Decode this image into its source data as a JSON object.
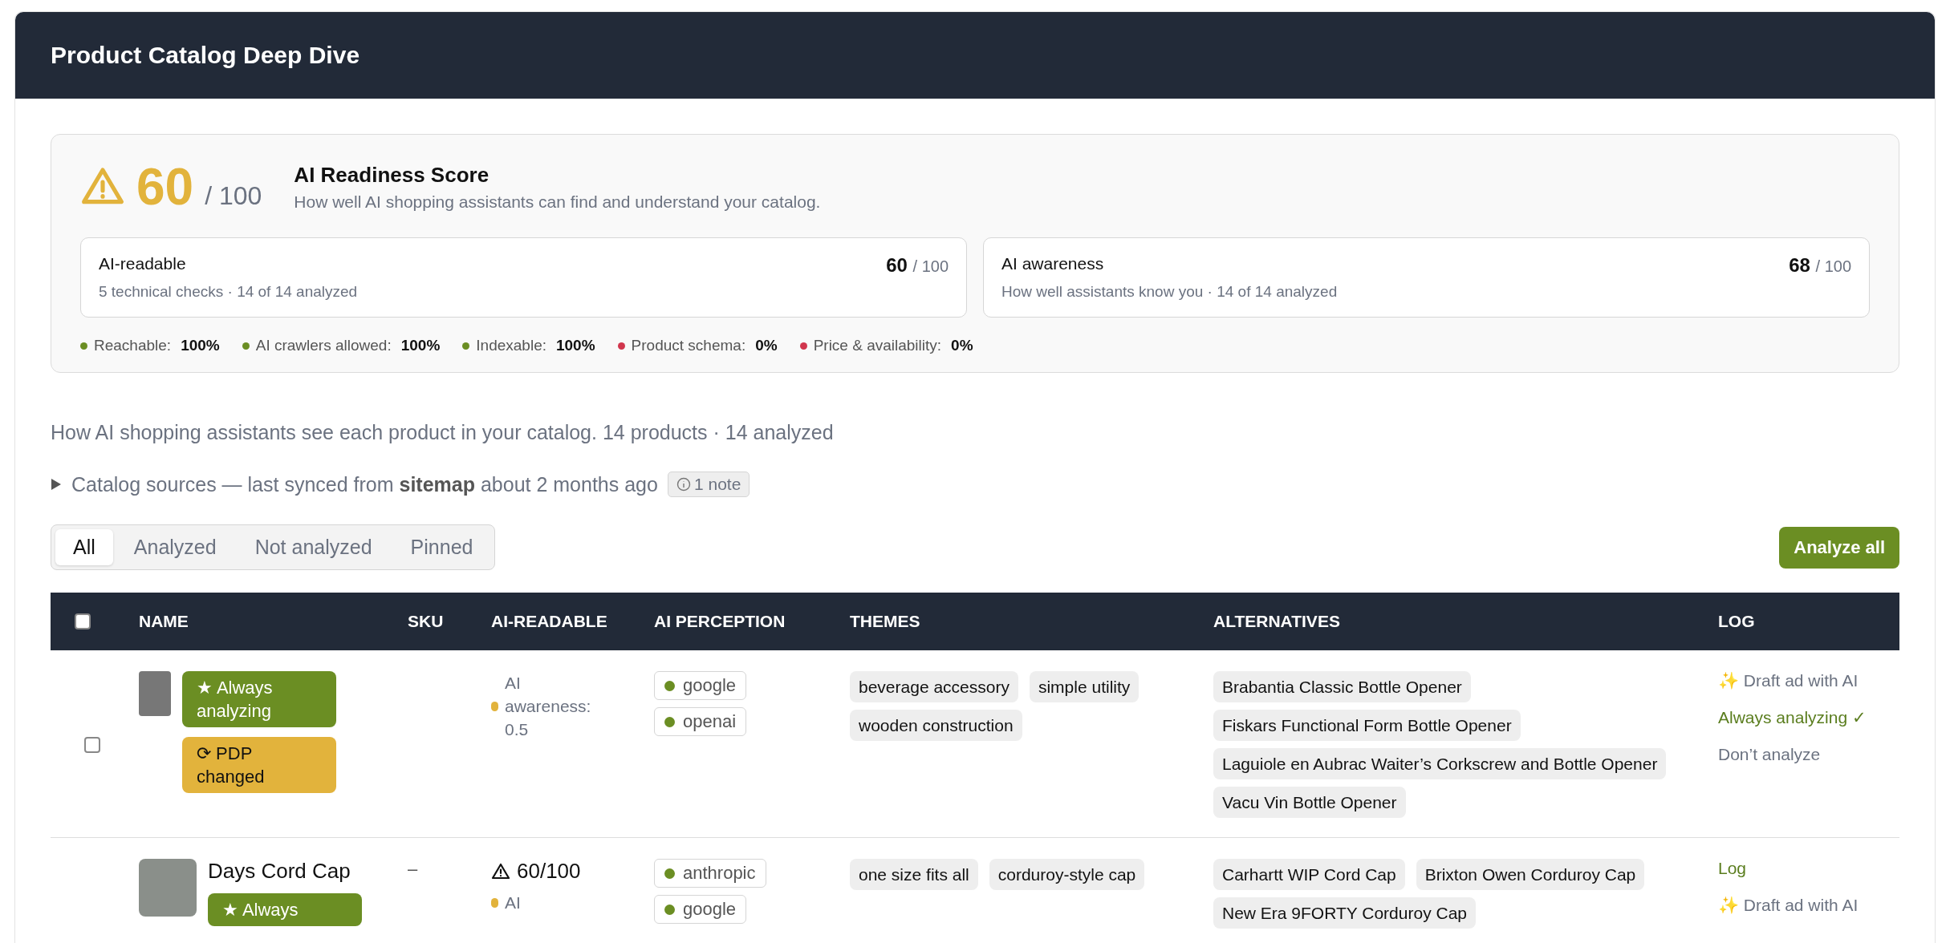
{
  "page": {
    "title": "Product Catalog Deep Dive"
  },
  "readiness": {
    "kind": "warning",
    "score": "60",
    "out_of": "/ 100",
    "title": "AI Readiness Score",
    "subtitle": "How well AI shopping assistants can find and understand your catalog.",
    "metrics": [
      {
        "label": "AI-readable",
        "detail": "5 technical checks · 14 of 14 analyzed",
        "score": "60",
        "out_of": "/ 100"
      },
      {
        "label": "AI awareness",
        "detail": "How well assistants know you · 14 of 14 analyzed",
        "score": "68",
        "out_of": "/ 100"
      }
    ],
    "checks": [
      {
        "label": "Reachable:",
        "value": "100%",
        "color": "#6b8e23"
      },
      {
        "label": "AI crawlers allowed:",
        "value": "100%",
        "color": "#6b8e23"
      },
      {
        "label": "Indexable:",
        "value": "100%",
        "color": "#6b8e23"
      },
      {
        "label": "Product schema:",
        "value": "0%",
        "color": "#d1364d"
      },
      {
        "label": "Price & availability:",
        "value": "0%",
        "color": "#d1364d"
      }
    ]
  },
  "summary": "How AI shopping assistants see each product in your catalog. 14 products · 14 analyzed",
  "sources": {
    "expanded": false,
    "text": "Catalog sources — last synced from **sitemap** about 2 months ago",
    "note": "1 note"
  },
  "filters": [
    {
      "label": "All",
      "selected": true
    },
    {
      "label": "Analyzed",
      "selected": false
    },
    {
      "label": "Not analyzed",
      "selected": false
    },
    {
      "label": "Pinned",
      "selected": false
    }
  ],
  "analyze_button": "Analyze all",
  "table": {
    "select_all": {
      "checked": false
    },
    "columns": [
      "NAME",
      "SKU",
      "AI-READABLE",
      "AI PERCEPTION",
      "THEMES",
      "ALTERNATIVES",
      "LOG"
    ],
    "rows": [
      {
        "checkbox": {
          "checked": false
        },
        "badges": [
          {
            "kind": "always",
            "label": "★ Always analyzing"
          },
          {
            "kind": "changed",
            "label": "⟳ PDP changed"
          }
        ],
        "readable": {
          "awareness_label": "AI awareness: 0.5",
          "color": "#e2b33c"
        },
        "perception": [
          {
            "label": "google",
            "color": "#6b8e23"
          },
          {
            "label": "openai",
            "color": "#6b8e23"
          }
        ],
        "themes": [
          "beverage accessory",
          "simple utility",
          "wooden construction"
        ],
        "alternatives": [
          "Brabantia Classic Bottle Opener",
          "Fiskars Functional Form Bottle Opener",
          "Laguiole en Aubrac Waiter’s Corkscrew and Bottle Opener",
          "Vacu Vin Bottle Opener"
        ],
        "log": [
          {
            "label": "✨ Draft ad with AI",
            "kind": "draft"
          },
          {
            "label": "Always analyzing ✓",
            "kind": "status"
          },
          {
            "label": "Don’t analyze",
            "kind": "action"
          }
        ]
      },
      {
        "name": "Days Cord Cap",
        "badges": [
          {
            "kind": "always",
            "label": "★ Always"
          }
        ],
        "sku": "–",
        "readable": {
          "kind": "warning",
          "score": "60/100",
          "awareness_label": "AI",
          "color": "#e2b33c"
        },
        "perception": [
          {
            "label": "anthropic",
            "color": "#6b8e23"
          },
          {
            "label": "google",
            "color": "#6b8e23"
          }
        ],
        "themes": [
          "one size fits all",
          "corduroy-style cap"
        ],
        "alternatives": [
          "Carhartt WIP Cord Cap",
          "Brixton Owen Corduroy Cap",
          "New Era 9FORTY Corduroy Cap"
        ],
        "log": [
          {
            "label": "Log",
            "kind": "link"
          },
          {
            "label": "✨ Draft ad with AI",
            "kind": "draft"
          }
        ]
      }
    ]
  }
}
